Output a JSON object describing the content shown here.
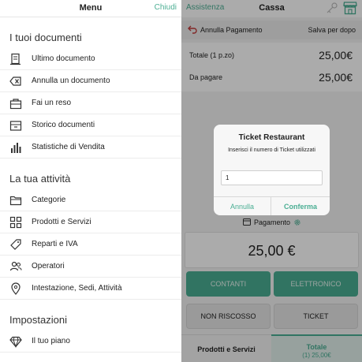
{
  "menu": {
    "title": "Menu",
    "close_label": "Chiudi",
    "sections": {
      "documents": {
        "title": "I tuoi documenti",
        "items": [
          "Ultimo documento",
          "Annulla un documento",
          "Fai un reso",
          "Storico documenti",
          "Statistiche di Vendita"
        ]
      },
      "activity": {
        "title": "La tua attività",
        "items": [
          "Categorie",
          "Prodotti e Servizi",
          "Reparti e IVA",
          "Operatori",
          "Intestazione, Sedi, Attività"
        ]
      },
      "settings": {
        "title": "Impostazioni",
        "items": [
          "Il tuo piano"
        ]
      }
    }
  },
  "cassa": {
    "assistenza_label": "Assistenza",
    "title": "Cassa",
    "annulla_pagamento": "Annulla Pagamento",
    "salva_per_dopo": "Salva per dopo",
    "totale_label": "Totale (1 p.zo)",
    "totale_value": "25,00€",
    "da_pagare_label": "Da pagare",
    "da_pagare_value": "25,00€",
    "pagamento_label": "Pagamento",
    "amount": "25,00 €",
    "buttons": {
      "contanti": "CONTANTI",
      "elettronico": "ELETTRONICO",
      "non_riscosso": "NON RISCOSSO",
      "ticket": "TICKET"
    },
    "tabs": {
      "prodotti": "Prodotti e Servizi",
      "totale": "Totale",
      "totale_sub": "(1)   25,00€"
    },
    "accent_color": "#4aae93"
  },
  "dialog": {
    "title": "Ticket Restaurant",
    "message": "Inserisci il numero di Ticket utilizzati",
    "input_value": "1",
    "cancel_label": "Annulla",
    "confirm_label": "Conferma"
  }
}
